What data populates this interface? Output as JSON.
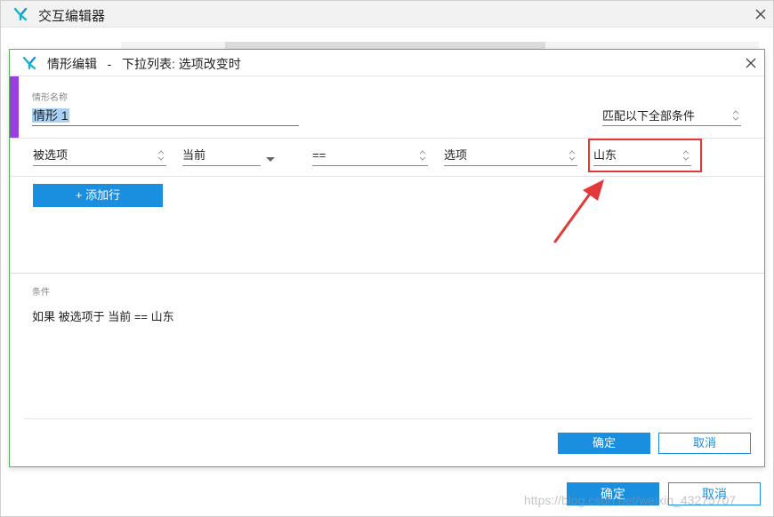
{
  "outer_window": {
    "title": "交互编辑器",
    "confirm_label": "确定",
    "cancel_label": "取消",
    "watermark": "https://blog.csdn.net/weixin_43275707"
  },
  "dialog": {
    "title": "情形编辑",
    "title_separator": "-",
    "title_context": "下拉列表: 选项改变时",
    "case_name_label": "情形名称",
    "case_name_value": "情形 1",
    "match_mode": "匹配以下全部条件",
    "condition_row": {
      "target": "被选项",
      "scope": "当前",
      "operator": "==",
      "value_type": "选项",
      "value": "山东"
    },
    "add_row_label": "+ 添加行",
    "conditions_label": "条件",
    "condition_summary": "如果  被选项于 当前 == 山东",
    "confirm_label": "确定",
    "cancel_label": "取消"
  },
  "colors": {
    "accent_blue": "#1a8fe0",
    "case_bar_purple": "#9b3ee0",
    "annotation_red": "#e23a3a",
    "dialog_border_green": "#58b35a"
  },
  "icons": [
    "app-logo-icon",
    "close-icon",
    "spinner-updown-icon",
    "dropdown-arrow-icon",
    "annotation-arrow-icon"
  ]
}
